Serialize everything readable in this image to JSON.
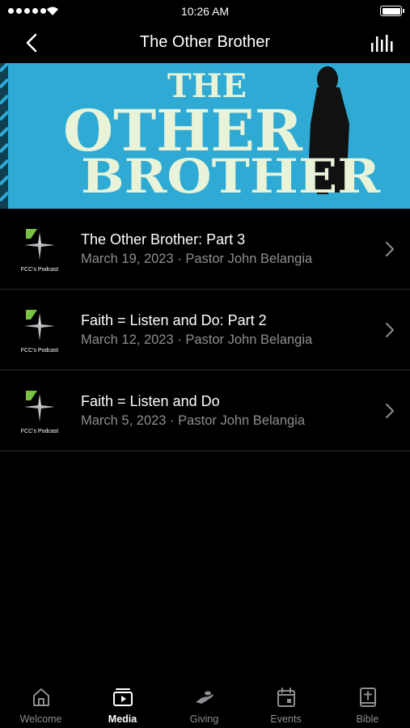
{
  "status_bar": {
    "time": "10:26 AM"
  },
  "nav": {
    "title": "The Other Brother"
  },
  "banner": {
    "line1": "THE",
    "line2": "OTHER",
    "line3": "BROTHER"
  },
  "episodes": [
    {
      "title": "The Other Brother: Part 3",
      "date": "March 19, 2023",
      "speaker": "Pastor John Belangia",
      "thumb_label": "FCC's Podcast"
    },
    {
      "title": "Faith = Listen and Do: Part 2",
      "date": "March 12, 2023",
      "speaker": "Pastor John Belangia",
      "thumb_label": "FCC's Podcast"
    },
    {
      "title": "Faith = Listen and Do",
      "date": "March 5, 2023",
      "speaker": "Pastor John Belangia",
      "thumb_label": "FCC's Podcast"
    }
  ],
  "tabs": [
    {
      "label": "Welcome",
      "icon": "home-icon",
      "active": false
    },
    {
      "label": "Media",
      "icon": "media-play-icon",
      "active": true
    },
    {
      "label": "Giving",
      "icon": "giving-hand-icon",
      "active": false
    },
    {
      "label": "Events",
      "icon": "calendar-icon",
      "active": false
    },
    {
      "label": "Bible",
      "icon": "bible-icon",
      "active": false
    }
  ],
  "colors": {
    "background": "#000000",
    "banner_blue": "#2eaad4",
    "banner_text": "#e8f3d8",
    "secondary_text": "#8e8e93",
    "logo_green": "#7ac143"
  }
}
